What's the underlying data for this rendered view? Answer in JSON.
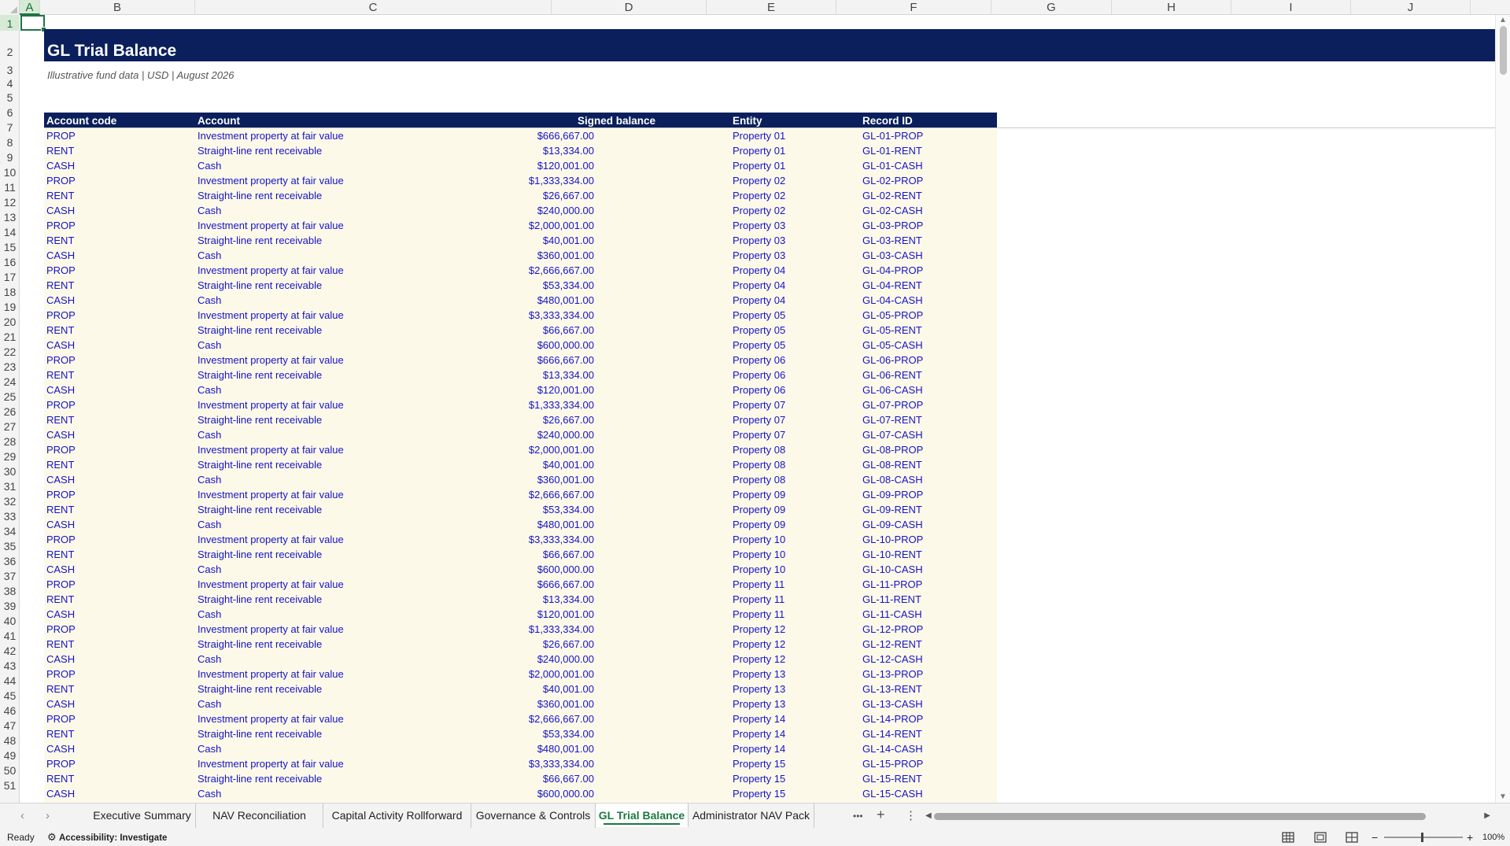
{
  "sheet": {
    "columns": [
      "A",
      "B",
      "C",
      "D",
      "E",
      "F",
      "G",
      "H",
      "I",
      "J"
    ],
    "selected_column": "A",
    "selected_row": "1",
    "title": "GL Trial Balance",
    "subtitle": "Illustrative fund data | USD | August 2026",
    "headers": {
      "code": "Account code",
      "account": "Account",
      "balance": "Signed balance",
      "entity": "Entity",
      "record": "Record ID"
    },
    "rows": [
      {
        "code": "PROP",
        "account": "Investment property at fair value",
        "balance": "$666,667.00",
        "entity": "Property 01",
        "record": "GL-01-PROP"
      },
      {
        "code": "RENT",
        "account": "Straight-line rent receivable",
        "balance": "$13,334.00",
        "entity": "Property 01",
        "record": "GL-01-RENT"
      },
      {
        "code": "CASH",
        "account": "Cash",
        "balance": "$120,001.00",
        "entity": "Property 01",
        "record": "GL-01-CASH"
      },
      {
        "code": "PROP",
        "account": "Investment property at fair value",
        "balance": "$1,333,334.00",
        "entity": "Property 02",
        "record": "GL-02-PROP"
      },
      {
        "code": "RENT",
        "account": "Straight-line rent receivable",
        "balance": "$26,667.00",
        "entity": "Property 02",
        "record": "GL-02-RENT"
      },
      {
        "code": "CASH",
        "account": "Cash",
        "balance": "$240,000.00",
        "entity": "Property 02",
        "record": "GL-02-CASH"
      },
      {
        "code": "PROP",
        "account": "Investment property at fair value",
        "balance": "$2,000,001.00",
        "entity": "Property 03",
        "record": "GL-03-PROP"
      },
      {
        "code": "RENT",
        "account": "Straight-line rent receivable",
        "balance": "$40,001.00",
        "entity": "Property 03",
        "record": "GL-03-RENT"
      },
      {
        "code": "CASH",
        "account": "Cash",
        "balance": "$360,001.00",
        "entity": "Property 03",
        "record": "GL-03-CASH"
      },
      {
        "code": "PROP",
        "account": "Investment property at fair value",
        "balance": "$2,666,667.00",
        "entity": "Property 04",
        "record": "GL-04-PROP"
      },
      {
        "code": "RENT",
        "account": "Straight-line rent receivable",
        "balance": "$53,334.00",
        "entity": "Property 04",
        "record": "GL-04-RENT"
      },
      {
        "code": "CASH",
        "account": "Cash",
        "balance": "$480,001.00",
        "entity": "Property 04",
        "record": "GL-04-CASH"
      },
      {
        "code": "PROP",
        "account": "Investment property at fair value",
        "balance": "$3,333,334.00",
        "entity": "Property 05",
        "record": "GL-05-PROP"
      },
      {
        "code": "RENT",
        "account": "Straight-line rent receivable",
        "balance": "$66,667.00",
        "entity": "Property 05",
        "record": "GL-05-RENT"
      },
      {
        "code": "CASH",
        "account": "Cash",
        "balance": "$600,000.00",
        "entity": "Property 05",
        "record": "GL-05-CASH"
      },
      {
        "code": "PROP",
        "account": "Investment property at fair value",
        "balance": "$666,667.00",
        "entity": "Property 06",
        "record": "GL-06-PROP"
      },
      {
        "code": "RENT",
        "account": "Straight-line rent receivable",
        "balance": "$13,334.00",
        "entity": "Property 06",
        "record": "GL-06-RENT"
      },
      {
        "code": "CASH",
        "account": "Cash",
        "balance": "$120,001.00",
        "entity": "Property 06",
        "record": "GL-06-CASH"
      },
      {
        "code": "PROP",
        "account": "Investment property at fair value",
        "balance": "$1,333,334.00",
        "entity": "Property 07",
        "record": "GL-07-PROP"
      },
      {
        "code": "RENT",
        "account": "Straight-line rent receivable",
        "balance": "$26,667.00",
        "entity": "Property 07",
        "record": "GL-07-RENT"
      },
      {
        "code": "CASH",
        "account": "Cash",
        "balance": "$240,000.00",
        "entity": "Property 07",
        "record": "GL-07-CASH"
      },
      {
        "code": "PROP",
        "account": "Investment property at fair value",
        "balance": "$2,000,001.00",
        "entity": "Property 08",
        "record": "GL-08-PROP"
      },
      {
        "code": "RENT",
        "account": "Straight-line rent receivable",
        "balance": "$40,001.00",
        "entity": "Property 08",
        "record": "GL-08-RENT"
      },
      {
        "code": "CASH",
        "account": "Cash",
        "balance": "$360,001.00",
        "entity": "Property 08",
        "record": "GL-08-CASH"
      },
      {
        "code": "PROP",
        "account": "Investment property at fair value",
        "balance": "$2,666,667.00",
        "entity": "Property 09",
        "record": "GL-09-PROP"
      },
      {
        "code": "RENT",
        "account": "Straight-line rent receivable",
        "balance": "$53,334.00",
        "entity": "Property 09",
        "record": "GL-09-RENT"
      },
      {
        "code": "CASH",
        "account": "Cash",
        "balance": "$480,001.00",
        "entity": "Property 09",
        "record": "GL-09-CASH"
      },
      {
        "code": "PROP",
        "account": "Investment property at fair value",
        "balance": "$3,333,334.00",
        "entity": "Property 10",
        "record": "GL-10-PROP"
      },
      {
        "code": "RENT",
        "account": "Straight-line rent receivable",
        "balance": "$66,667.00",
        "entity": "Property 10",
        "record": "GL-10-RENT"
      },
      {
        "code": "CASH",
        "account": "Cash",
        "balance": "$600,000.00",
        "entity": "Property 10",
        "record": "GL-10-CASH"
      },
      {
        "code": "PROP",
        "account": "Investment property at fair value",
        "balance": "$666,667.00",
        "entity": "Property 11",
        "record": "GL-11-PROP"
      },
      {
        "code": "RENT",
        "account": "Straight-line rent receivable",
        "balance": "$13,334.00",
        "entity": "Property 11",
        "record": "GL-11-RENT"
      },
      {
        "code": "CASH",
        "account": "Cash",
        "balance": "$120,001.00",
        "entity": "Property 11",
        "record": "GL-11-CASH"
      },
      {
        "code": "PROP",
        "account": "Investment property at fair value",
        "balance": "$1,333,334.00",
        "entity": "Property 12",
        "record": "GL-12-PROP"
      },
      {
        "code": "RENT",
        "account": "Straight-line rent receivable",
        "balance": "$26,667.00",
        "entity": "Property 12",
        "record": "GL-12-RENT"
      },
      {
        "code": "CASH",
        "account": "Cash",
        "balance": "$240,000.00",
        "entity": "Property 12",
        "record": "GL-12-CASH"
      },
      {
        "code": "PROP",
        "account": "Investment property at fair value",
        "balance": "$2,000,001.00",
        "entity": "Property 13",
        "record": "GL-13-PROP"
      },
      {
        "code": "RENT",
        "account": "Straight-line rent receivable",
        "balance": "$40,001.00",
        "entity": "Property 13",
        "record": "GL-13-RENT"
      },
      {
        "code": "CASH",
        "account": "Cash",
        "balance": "$360,001.00",
        "entity": "Property 13",
        "record": "GL-13-CASH"
      },
      {
        "code": "PROP",
        "account": "Investment property at fair value",
        "balance": "$2,666,667.00",
        "entity": "Property 14",
        "record": "GL-14-PROP"
      },
      {
        "code": "RENT",
        "account": "Straight-line rent receivable",
        "balance": "$53,334.00",
        "entity": "Property 14",
        "record": "GL-14-RENT"
      },
      {
        "code": "CASH",
        "account": "Cash",
        "balance": "$480,001.00",
        "entity": "Property 14",
        "record": "GL-14-CASH"
      },
      {
        "code": "PROP",
        "account": "Investment property at fair value",
        "balance": "$3,333,334.00",
        "entity": "Property 15",
        "record": "GL-15-PROP"
      },
      {
        "code": "RENT",
        "account": "Straight-line rent receivable",
        "balance": "$66,667.00",
        "entity": "Property 15",
        "record": "GL-15-RENT"
      },
      {
        "code": "CASH",
        "account": "Cash",
        "balance": "$600,000.00",
        "entity": "Property 15",
        "record": "GL-15-CASH"
      }
    ]
  },
  "tabs": {
    "prev_icon": "chevron-left-icon",
    "next_icon": "chevron-right-icon",
    "items": [
      {
        "label": "Executive Summary",
        "active": false
      },
      {
        "label": "NAV Reconciliation",
        "active": false
      },
      {
        "label": "Capital Activity Rollforward",
        "active": false
      },
      {
        "label": "Governance & Controls",
        "active": false
      },
      {
        "label": "GL Trial Balance",
        "active": true
      },
      {
        "label": "Administrator NAV Pack",
        "active": false
      }
    ],
    "more_label": "•••",
    "add_label": "+",
    "options_label": "⋮"
  },
  "status": {
    "ready": "Ready",
    "accessibility": "Accessibility: Investigate",
    "zoom_minus": "−",
    "zoom_plus": "+",
    "zoom_level": "100%"
  },
  "colors": {
    "banner": "#0a1f5c",
    "data_text": "#1414c8",
    "table_fill": "#fdf9e9",
    "excel_green": "#217346"
  }
}
